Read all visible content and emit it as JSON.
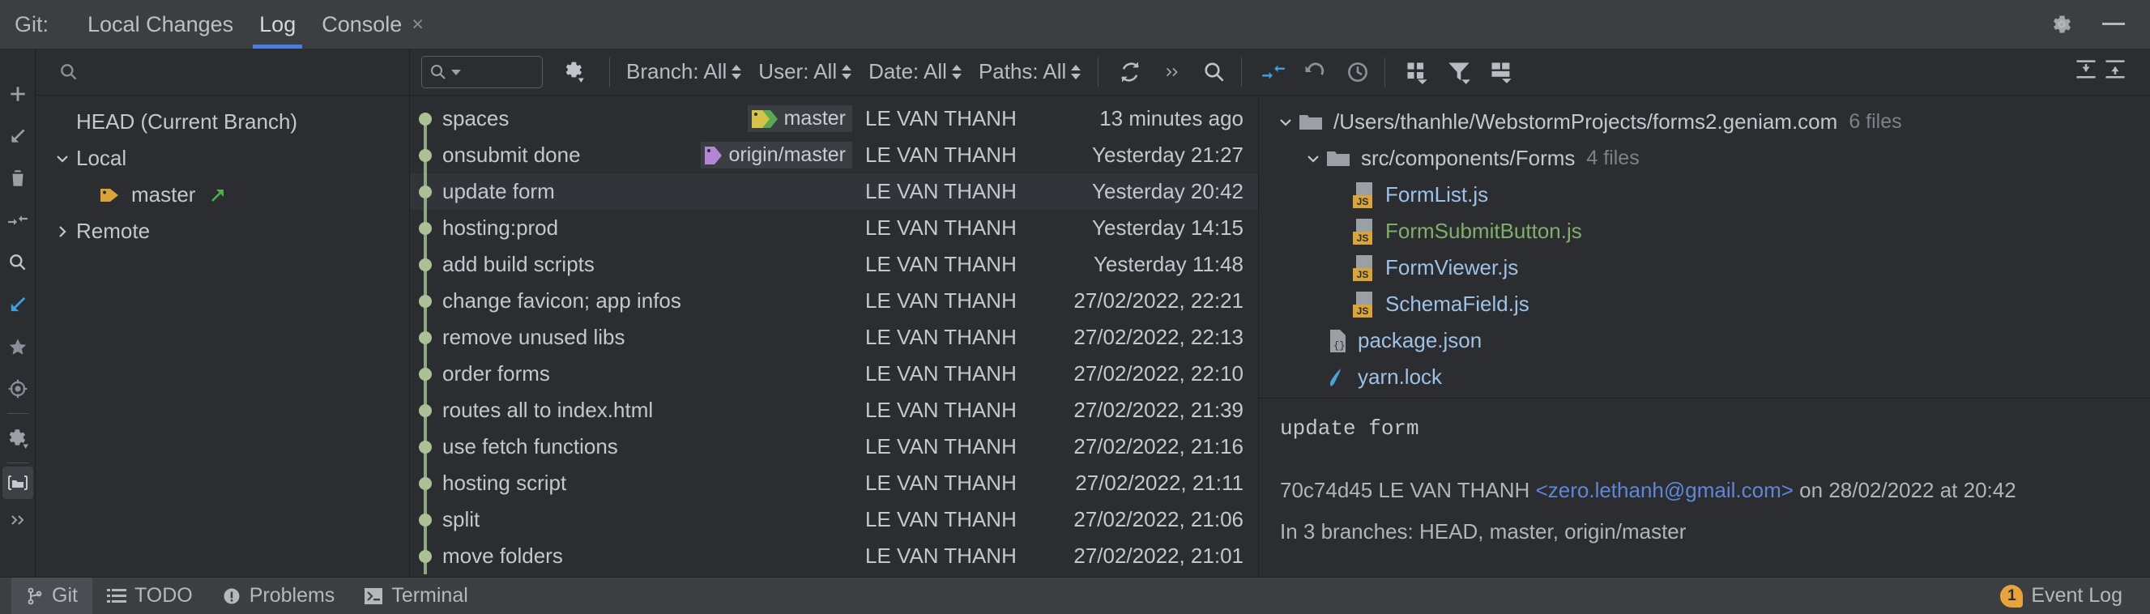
{
  "window": {
    "git_label": "Git:",
    "tabs": [
      {
        "label": "Local Changes",
        "active": false,
        "closable": false
      },
      {
        "label": "Log",
        "active": true,
        "closable": false
      },
      {
        "label": "Console",
        "active": false,
        "closable": true
      }
    ],
    "close_glyph": "×",
    "titlebar_icons": [
      "gear-icon",
      "minimize-icon"
    ],
    "minimize_glyph": "—"
  },
  "left_strip": {
    "icons": [
      "plus-icon",
      "checkout-arrow-icon",
      "delete-trash-icon",
      "collapse-arrows-icon",
      "search-icon",
      "update-arrow-icon",
      "star-favorite-icon",
      "target-icon",
      "settings-gear-icon",
      "folder-icon",
      "expand-chevrons-icon"
    ]
  },
  "toolbar": {
    "search_placeholder": "",
    "search_value": "",
    "gear_icon": "settings-gear-icon",
    "filters": [
      {
        "name": "branch",
        "label": "Branch: All"
      },
      {
        "name": "user",
        "label": "User: All"
      },
      {
        "name": "date",
        "label": "Date: All"
      },
      {
        "name": "paths",
        "label": "Paths: All"
      }
    ],
    "actions_left": [
      "refresh-icon",
      "more-chevrons-icon",
      "search-icon"
    ],
    "actions_mid": [
      "collapse-arrows-icon",
      "revert-undo-icon",
      "history-clock-icon"
    ],
    "actions_right_group": [
      "grid-columns-icon",
      "filter-funnel-icon",
      "layout-icon"
    ],
    "actions_far_right": [
      "expand-all-icon",
      "collapse-all-icon"
    ]
  },
  "branches": {
    "rows": [
      {
        "label": "HEAD (Current Branch)",
        "indent": 1,
        "chevron": "none",
        "icon": "none",
        "arrow": false
      },
      {
        "label": "Local",
        "indent": 0,
        "chevron": "down",
        "icon": "none",
        "arrow": false
      },
      {
        "label": "master",
        "indent": 1,
        "chevron": "none",
        "icon": "branch-tag-icon",
        "arrow": true
      },
      {
        "label": "Remote",
        "indent": 0,
        "chevron": "right",
        "icon": "none",
        "arrow": false
      }
    ]
  },
  "commits": {
    "columns": [
      "subject",
      "refs",
      "author",
      "date"
    ],
    "rows": [
      {
        "subject": "spaces",
        "refs": [
          {
            "name": "master",
            "icon": "branch-label-icon",
            "color": "#d6c44a"
          }
        ],
        "author": "LE VAN THANH",
        "date": "13 minutes ago",
        "selected": false
      },
      {
        "subject": "onsubmit done",
        "refs": [
          {
            "name": "origin/master",
            "icon": "remote-label-icon",
            "color": "#b586d6"
          }
        ],
        "author": "LE VAN THANH",
        "date": "Yesterday 21:27",
        "selected": false
      },
      {
        "subject": "update form",
        "refs": [],
        "author": "LE VAN THANH",
        "date": "Yesterday 20:42",
        "selected": true
      },
      {
        "subject": "hosting:prod",
        "refs": [],
        "author": "LE VAN THANH",
        "date": "Yesterday 14:15",
        "selected": false
      },
      {
        "subject": "add build scripts",
        "refs": [],
        "author": "LE VAN THANH",
        "date": "Yesterday 11:48",
        "selected": false
      },
      {
        "subject": "change favicon; app infos",
        "refs": [],
        "author": "LE VAN THANH",
        "date": "27/02/2022, 22:21",
        "selected": false
      },
      {
        "subject": "remove unused libs",
        "refs": [],
        "author": "LE VAN THANH",
        "date": "27/02/2022, 22:13",
        "selected": false
      },
      {
        "subject": "order forms",
        "refs": [],
        "author": "LE VAN THANH",
        "date": "27/02/2022, 22:10",
        "selected": false
      },
      {
        "subject": "routes all to index.html",
        "refs": [],
        "author": "LE VAN THANH",
        "date": "27/02/2022, 21:39",
        "selected": false
      },
      {
        "subject": "use fetch functions",
        "refs": [],
        "author": "LE VAN THANH",
        "date": "27/02/2022, 21:16",
        "selected": false
      },
      {
        "subject": "hosting script",
        "refs": [],
        "author": "LE VAN THANH",
        "date": "27/02/2022, 21:11",
        "selected": false
      },
      {
        "subject": "split",
        "refs": [],
        "author": "LE VAN THANH",
        "date": "27/02/2022, 21:06",
        "selected": false
      },
      {
        "subject": "move folders",
        "refs": [],
        "author": "LE VAN THANH",
        "date": "27/02/2022, 21:01",
        "selected": false
      }
    ]
  },
  "changed_files": {
    "rows": [
      {
        "label": "/Users/thanhle/WebstormProjects/forms2.geniam.com",
        "count": "6 files",
        "indent": 0,
        "chevron": "down",
        "icon": "folder-icon",
        "kind": "dir"
      },
      {
        "label": "src/components/Forms",
        "count": "4 files",
        "indent": 1,
        "chevron": "down",
        "icon": "folder-icon",
        "kind": "dir"
      },
      {
        "label": "FormList.js",
        "count": "",
        "indent": 2,
        "chevron": "none",
        "icon": "js-file-icon",
        "kind": "file"
      },
      {
        "label": "FormSubmitButton.js",
        "count": "",
        "indent": 2,
        "chevron": "none",
        "icon": "js-file-icon",
        "kind": "file-added"
      },
      {
        "label": "FormViewer.js",
        "count": "",
        "indent": 2,
        "chevron": "none",
        "icon": "js-file-icon",
        "kind": "file"
      },
      {
        "label": "SchemaField.js",
        "count": "",
        "indent": 2,
        "chevron": "none",
        "icon": "js-file-icon",
        "kind": "file"
      },
      {
        "label": "package.json",
        "count": "",
        "indent": 1,
        "chevron": "none",
        "icon": "json-file-icon",
        "kind": "file"
      },
      {
        "label": "yarn.lock",
        "count": "",
        "indent": 1,
        "chevron": "none",
        "icon": "yarn-file-icon",
        "kind": "file"
      }
    ]
  },
  "commit_details": {
    "message": "update form",
    "hash": "70c74d45",
    "author": "LE VAN THANH",
    "email": "<zero.lethanh@gmail.com>",
    "on_word": "on",
    "date": "28/02/2022",
    "at_word": "at",
    "time": "20:42",
    "branches_line": "In 3 branches: HEAD, master, origin/master"
  },
  "statusbar": {
    "items": [
      {
        "label": "Git",
        "icon": "git-branch-icon",
        "active": true
      },
      {
        "label": "TODO",
        "icon": "todo-list-icon",
        "active": false
      },
      {
        "label": "Problems",
        "icon": "problems-warning-icon",
        "active": false
      },
      {
        "label": "Terminal",
        "icon": "terminal-icon",
        "active": false
      }
    ],
    "event_log": {
      "label": "Event Log",
      "badge": "1",
      "badge_color": "#e8a33d"
    }
  },
  "colors": {
    "accent_blue": "#4a7fe0",
    "graph_green": "#a9c194",
    "link_blue": "#5f87d8",
    "added_green": "#7fb069",
    "tag_orange": "#d9a43b"
  }
}
